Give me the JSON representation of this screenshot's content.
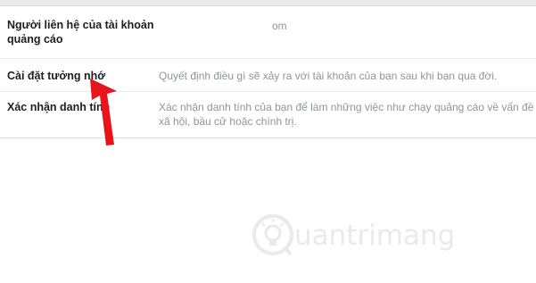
{
  "settings": {
    "rows": [
      {
        "label_line1": "Người liên hệ của tài khoản",
        "label_line2": "quảng cáo",
        "value": "om"
      },
      {
        "label": "Cài đặt tưởng nhớ",
        "value": "Quyết định điều gì sẽ xảy ra với tài khoản của bạn sau khi bạn qua đời."
      },
      {
        "label": "Xác nhận danh tính",
        "value": "Xác nhận danh tính của bạn để làm những việc như chạy quảng cáo về vấn đề xã hội, bầu cử hoặc chính trị."
      }
    ]
  },
  "annotation": {
    "arrow_color": "#e8141c"
  },
  "watermark": {
    "text": "uantrimang",
    "icon": "quantrimang-logo-icon"
  }
}
